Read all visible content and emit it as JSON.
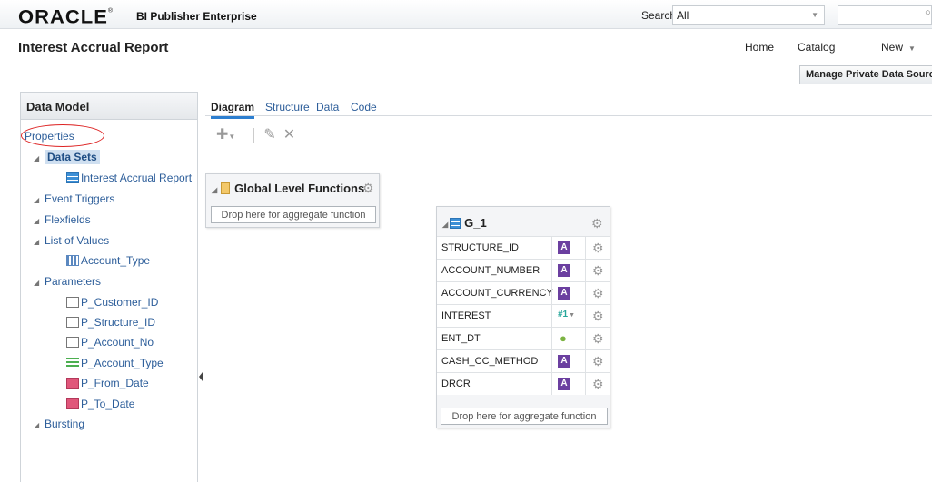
{
  "header": {
    "logo": "ORACLE",
    "logo_mark": "®",
    "product": "BI Publisher Enterprise",
    "search_label": "Search",
    "search_scope": "All",
    "search_value": ""
  },
  "page": {
    "title": "Interest Accrual Report"
  },
  "nav": {
    "home": "Home",
    "catalog": "Catalog",
    "new": "New",
    "manage_private_data_sources": "Manage Private Data Sources"
  },
  "left_panel": {
    "title": "Data Model",
    "properties": "Properties",
    "data_sets": "Data Sets",
    "data_set_items": [
      "Interest Accrual Report"
    ],
    "event_triggers": "Event Triggers",
    "flexfields": "Flexfields",
    "list_of_values": "List of Values",
    "lov_items": [
      "Account_Type"
    ],
    "parameters": "Parameters",
    "parameter_items": [
      "P_Customer_ID",
      "P_Structure_ID",
      "P_Account_No",
      "P_Account_Type",
      "P_From_Date",
      "P_To_Date"
    ],
    "bursting": "Bursting"
  },
  "tabs": [
    "Diagram",
    "Structure",
    "Data",
    "Code"
  ],
  "global_level_functions": {
    "title": "Global Level Functions",
    "drop_hint": "Drop here for aggregate function"
  },
  "group": {
    "name": "G_1",
    "columns": [
      {
        "name": "STRUCTURE_ID",
        "type": "A"
      },
      {
        "name": "ACCOUNT_NUMBER",
        "type": "A"
      },
      {
        "name": "ACCOUNT_CURRENCY",
        "type": "A"
      },
      {
        "name": "INTEREST",
        "type": "#1"
      },
      {
        "name": "ENT_DT",
        "type": "date"
      },
      {
        "name": "CASH_CC_METHOD",
        "type": "A"
      },
      {
        "name": "DRCR",
        "type": "A"
      }
    ],
    "drop_hint": "Drop here for aggregate function"
  },
  "colors": {
    "link": "#2d5e9a",
    "tab_active_underline": "#2d7fd0",
    "highlight_ellipse": "#dd2222",
    "string_type": "#6b3fa0",
    "number_type": "#26a69a"
  }
}
